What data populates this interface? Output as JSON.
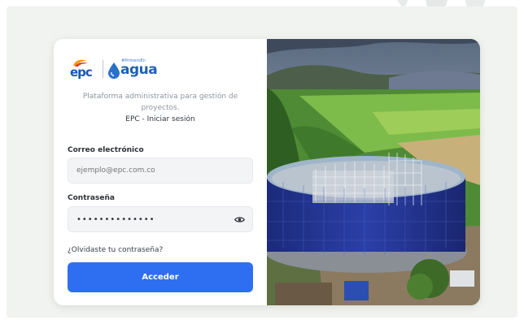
{
  "brand": {
    "company_logo_text": "epc",
    "campaign_small_text": "#PrimeroEn",
    "campaign_logo_text": "agua",
    "logo_orange": "#f59a1c",
    "logo_red": "#e53a2e",
    "logo_blue": "#1a56b4"
  },
  "login": {
    "subtitle": "Plataforma administrativa para gestión de proyectos.",
    "title": "EPC - Iniciar sesión",
    "email_label": "Correo electrónico",
    "email_placeholder": "ejemplo@epc.com.co",
    "password_label": "Contraseña",
    "password_value": "••••••••••••••",
    "forgot_password": "¿Olvidaste tu contraseña?",
    "submit_label": "Acceder"
  },
  "icons": {
    "show_password": "eye-icon"
  },
  "colors": {
    "page_background": "#f1f3f0",
    "card_background": "#ffffff",
    "primary_button": "#2e6ff2",
    "input_background": "#f3f4f6"
  }
}
